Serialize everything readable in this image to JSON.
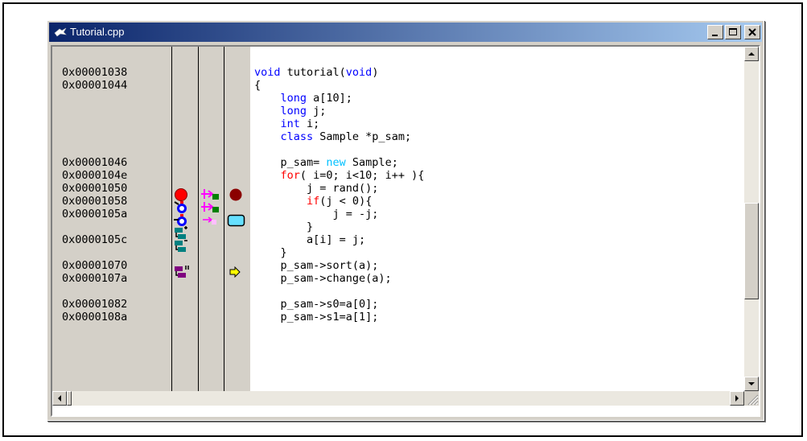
{
  "window": {
    "title": "Tutorial.cpp"
  },
  "addresses": [
    {
      "id": "a0",
      "text": "0x00001038"
    },
    {
      "id": "a1",
      "text": "0x00001044"
    },
    {
      "id": "a2",
      "text": "0x00001046"
    },
    {
      "id": "a3",
      "text": "0x0000104e"
    },
    {
      "id": "a4",
      "text": "0x00001050"
    },
    {
      "id": "a5",
      "text": "0x00001058"
    },
    {
      "id": "a6",
      "text": "0x0000105a"
    },
    {
      "id": "a7",
      "text": "0x0000105c"
    },
    {
      "id": "a8",
      "text": "0x00001070"
    },
    {
      "id": "a9",
      "text": "0x0000107a"
    },
    {
      "id": "a10",
      "text": "0x00001082"
    },
    {
      "id": "a11",
      "text": "0x0000108a"
    }
  ],
  "code": [
    [
      {
        "t": "void",
        "c": "kw"
      },
      {
        "t": " tutorial("
      },
      {
        "t": "void",
        "c": "kw"
      },
      {
        "t": ")"
      }
    ],
    [
      {
        "t": "{"
      }
    ],
    [
      {
        "t": "    "
      },
      {
        "t": "long",
        "c": "kw"
      },
      {
        "t": " a[10];"
      }
    ],
    [
      {
        "t": "    "
      },
      {
        "t": "long",
        "c": "kw"
      },
      {
        "t": " j;"
      }
    ],
    [
      {
        "t": "    "
      },
      {
        "t": "int",
        "c": "kw"
      },
      {
        "t": " i;"
      }
    ],
    [
      {
        "t": "    "
      },
      {
        "t": "class",
        "c": "kw"
      },
      {
        "t": " Sample *p_sam;"
      }
    ],
    [
      {
        "t": ""
      }
    ],
    [
      {
        "t": "    p_sam= "
      },
      {
        "t": "new",
        "c": "kw3"
      },
      {
        "t": " Sample;"
      }
    ],
    [
      {
        "t": "    "
      },
      {
        "t": "for",
        "c": "kw2"
      },
      {
        "t": "( i=0; i<10; i++ ){"
      }
    ],
    [
      {
        "t": "        j = rand();"
      }
    ],
    [
      {
        "t": "        "
      },
      {
        "t": "if",
        "c": "kw2"
      },
      {
        "t": "(j < 0){"
      }
    ],
    [
      {
        "t": "            j = -j;"
      }
    ],
    [
      {
        "t": "        }"
      }
    ],
    [
      {
        "t": "        a[i] = j;"
      }
    ],
    [
      {
        "t": "    }"
      }
    ],
    [
      {
        "t": "    p_sam->sort(a);"
      }
    ],
    [
      {
        "t": "    p_sam->change(a);"
      }
    ],
    [
      {
        "t": ""
      }
    ],
    [
      {
        "t": "    p_sam->s0=a[0];"
      }
    ],
    [
      {
        "t": "    p_sam->s1=a[1];"
      }
    ]
  ],
  "colors": {
    "titlebar_start": "#0a246a",
    "titlebar_end": "#a6caf0",
    "keyword": "#0000ff",
    "control": "#ff0000",
    "new_kw": "#00c0ff",
    "breakpoint": "#8b0000"
  }
}
